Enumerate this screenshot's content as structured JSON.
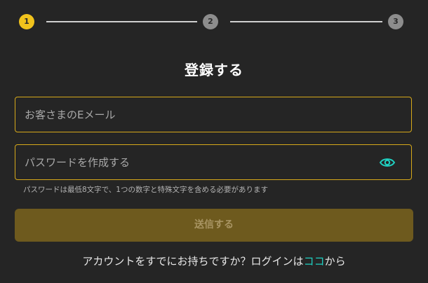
{
  "stepper": {
    "steps": [
      {
        "label": "1",
        "state": "active"
      },
      {
        "label": "2",
        "state": "inactive"
      },
      {
        "label": "3",
        "state": "inactive"
      }
    ]
  },
  "form": {
    "title": "登録する",
    "email": {
      "value": "",
      "placeholder": "お客さまのEメール"
    },
    "password": {
      "value": "",
      "placeholder": "パスワードを作成する",
      "toggle_icon": "eye-icon"
    },
    "password_hint": "パスワードは最低8文字で、1つの数字と特殊文字を含める必要があります",
    "submit_label": "送信する"
  },
  "login_prompt": {
    "text": "アカウントをすでにお持ちですか？ログインは",
    "link_label": "ココ",
    "suffix": "から"
  },
  "colors": {
    "background": "#252525",
    "accent": "#f1c31c",
    "field_border": "#d7a91a",
    "link": "#1fd0c1",
    "submit_bg": "#6e5a1e"
  }
}
